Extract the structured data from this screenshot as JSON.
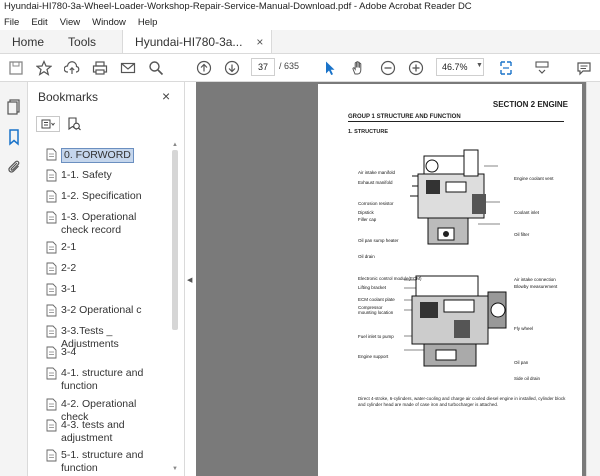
{
  "window": {
    "title": "Hyundai-HI780-3a-Wheel-Loader-Workshop-Repair-Service-Manual-Download.pdf - Adobe Acrobat Reader DC"
  },
  "menu": {
    "file": "File",
    "edit": "Edit",
    "view": "View",
    "window": "Window",
    "help": "Help"
  },
  "tabs": {
    "home": "Home",
    "tools": "Tools",
    "doc": "Hyundai-HI780-3a...",
    "close": "×"
  },
  "toolbar": {
    "page_current": "37",
    "page_total": "/ 635",
    "zoom": "46.7%"
  },
  "bookmarks": {
    "title": "Bookmarks",
    "close": "×",
    "items": [
      "0. FORWORD",
      "1-1. Safety",
      "1-2. Specification",
      "1-3. Operational check record",
      "2-1",
      "2-2",
      "3-1",
      "3-2 Operational c",
      "3-3.Tests _ Adjustments",
      "3-4",
      "4-1. structure and function",
      "4-2. Operational check",
      "4-3. tests and adjustment",
      "5-1. structure and function"
    ]
  },
  "doc_page": {
    "section": "SECTION 2 ENGINE",
    "group": "GROUP 1 STRUCTURE AND FUNCTION",
    "structure": "1. STRUCTURE",
    "labels_top": {
      "air_intake": "Air intake manifold",
      "exhaust": "Exhaust manifold",
      "corrosion": "Corrosion resistor",
      "dipstick": "Dipstick",
      "filler": "Filler cap",
      "oilpan_heater": "Oil pan sump heater",
      "oil_drain": "Oil drain",
      "coolant_vent": "Engine coolant vent",
      "coolant_inlet": "Coolant inlet",
      "oil_filter": "Oil filter"
    },
    "labels_bottom": {
      "ecm": "Electronic control module(ECM)",
      "lifting": "Lifting bracket",
      "ecm_plate": "ECM coolant plate",
      "compressor": "Compressor mounting location",
      "fuel": "Fuel inlet to pump",
      "support": "Engine support",
      "air_conn": "Air intake connection",
      "blowby": "Blowby measurement",
      "flywheel": "Fly wheel",
      "oil_pan": "Oil pan",
      "side_drain": "Side oil drain"
    },
    "description": "Direct 4-stroke, 6-cylinders, water-cooling and charge air cooled diesel engine in installed, cylinder block and cylinder head are made of case iron and turbocharger is attached."
  }
}
